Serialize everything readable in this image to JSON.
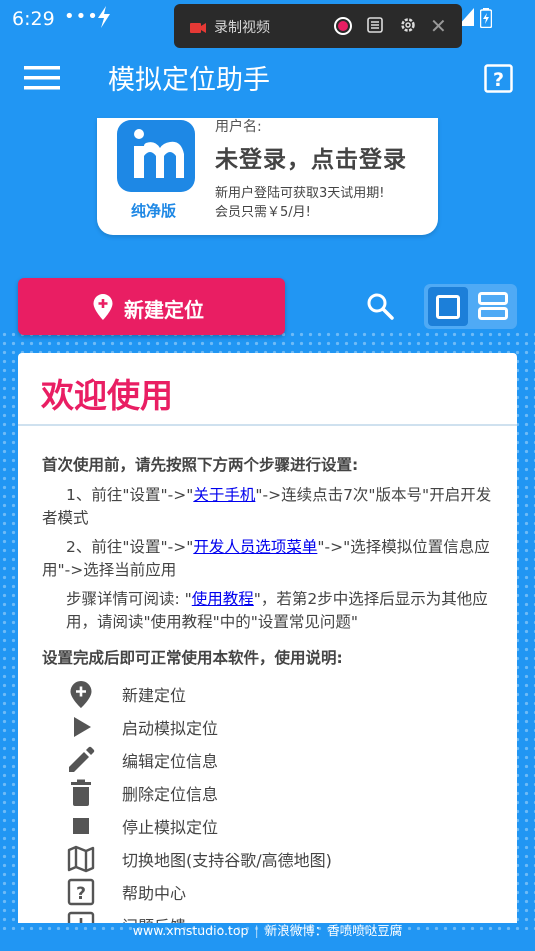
{
  "status_bar": {
    "time": "6:29",
    "dots": "•••"
  },
  "recorder": {
    "label": "录制视频"
  },
  "app_bar": {
    "title": "模拟定位助手"
  },
  "user_card": {
    "logo_label": "纯净版",
    "user_name_label": "用户名:",
    "login_text": "未登录，点击登录",
    "promo_line1": "新用户登陆可获取3天试用期!",
    "promo_line2": "会员只需￥5/月!"
  },
  "actions": {
    "new_location_label": "新建定位"
  },
  "welcome": {
    "title": "欢迎使用",
    "intro": "首次使用前，请先按照下方两个步骤进行设置:",
    "step1": {
      "prefix": "1、前往\"设置\"->\"",
      "link": "关于手机",
      "suffix": "\"->连续点击7次\"版本号\"开启开发者模式"
    },
    "step2": {
      "prefix": "2、前往\"设置\"->\"",
      "link": "开发人员选项菜单",
      "suffix": "\"->\"选择模拟位置信息应用\"->选择当前应用"
    },
    "step3": {
      "prefix": "步骤详情可阅读: \"",
      "link": "使用教程",
      "suffix": "\"，若第2步中选择后显示为其他应用，请阅读\"使用教程\"中的\"设置常见问题\""
    },
    "usage_title": "设置完成后即可正常使用本软件，使用说明:",
    "features": [
      {
        "icon": "add-location-icon",
        "label": "新建定位"
      },
      {
        "icon": "play-icon",
        "label": "启动模拟定位"
      },
      {
        "icon": "edit-icon",
        "label": "编辑定位信息"
      },
      {
        "icon": "delete-icon",
        "label": "删除定位信息"
      },
      {
        "icon": "stop-icon",
        "label": "停止模拟定位"
      },
      {
        "icon": "map-icon",
        "label": "切换地图(支持谷歌/高德地图)"
      },
      {
        "icon": "help-icon",
        "label": "帮助中心"
      },
      {
        "icon": "feedback-icon",
        "label": "问题反馈"
      }
    ]
  },
  "footer": {
    "website": "www.xmstudio.top",
    "weibo": "新浪微博：香喷喷哒豆腐"
  },
  "colors": {
    "primary": "#2196f3",
    "accent": "#e91e63",
    "link": "#0000ee"
  }
}
